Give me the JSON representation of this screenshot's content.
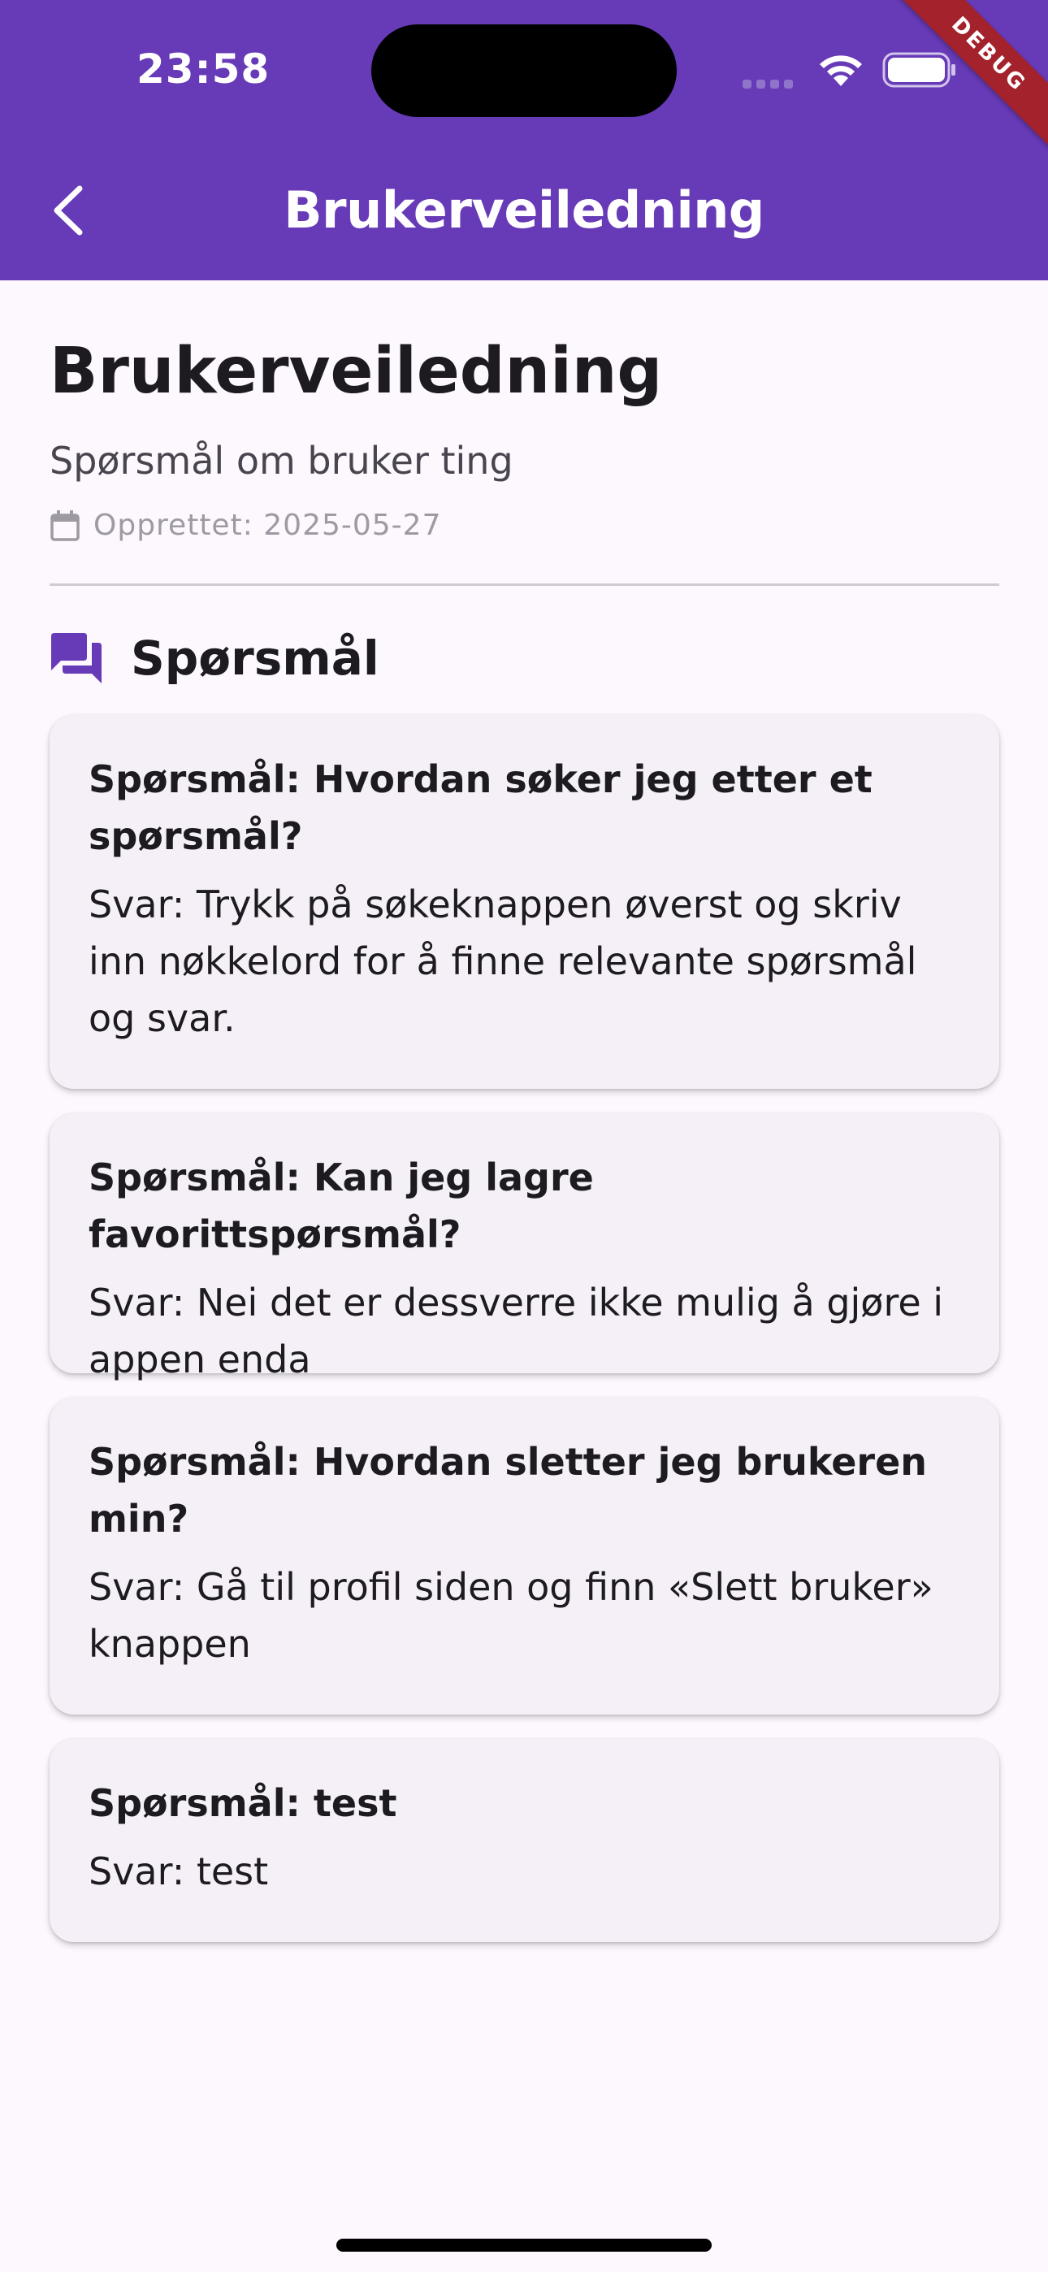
{
  "status_bar": {
    "time": "23:58"
  },
  "debug_banner": "DEBUG",
  "appbar": {
    "title": "Brukerveiledning"
  },
  "header": {
    "title": "Brukerveiledning",
    "subtitle": "Spørsmål om bruker ting",
    "created": "Opprettet: 2025-05-27"
  },
  "section": {
    "title": "Spørsmål"
  },
  "faq": [
    {
      "question": "Spørsmål: Hvordan søker jeg etter et spørsmål?",
      "answer": "Svar: Trykk på søkeknappen øverst og skriv inn nøkkelord for å finne relevante spørsmål og svar."
    },
    {
      "question": "Spørsmål: Kan jeg lagre favorittspørsmål?",
      "answer": "Svar: Nei det er dessverre ikke mulig å gjøre i appen enda"
    },
    {
      "question": "Spørsmål: Hvordan sletter jeg brukeren min?",
      "answer": "Svar: Gå til profil siden og finn «Slett bruker» knappen"
    },
    {
      "question": "Spørsmål: test",
      "answer": "Svar: test"
    }
  ],
  "icons": {
    "back": "chevron-left-icon",
    "calendar": "calendar-icon",
    "section": "forum-icon"
  },
  "colors": {
    "primary": "#673ab7",
    "background": "#fdf7fe",
    "card": "#f5f0f7"
  }
}
